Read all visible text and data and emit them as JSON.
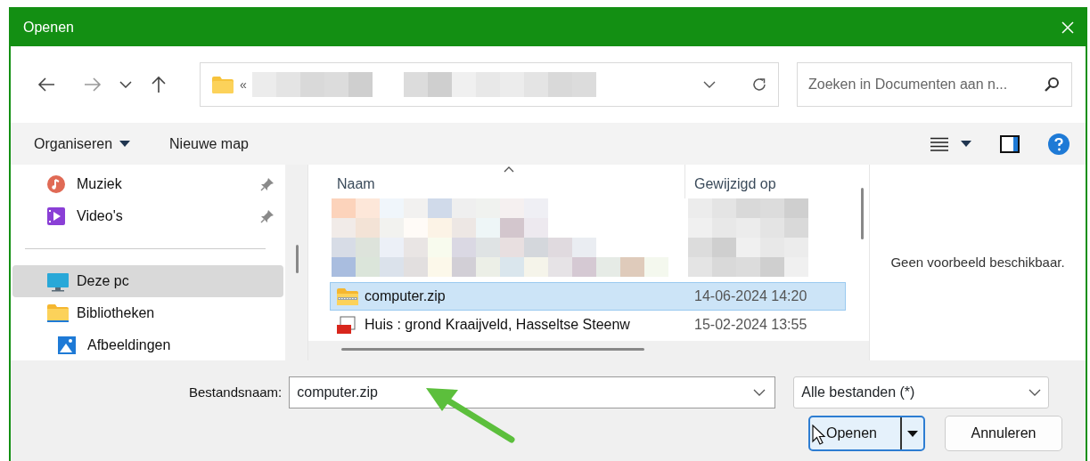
{
  "window": {
    "title": "Openen"
  },
  "navigation": {
    "address_prefix": "«"
  },
  "search": {
    "placeholder": "Zoeken in Documenten aan n..."
  },
  "toolbar": {
    "organize": "Organiseren",
    "new_folder": "Nieuwe map"
  },
  "sidebar": {
    "items": [
      {
        "kind": "music",
        "label": "Muziek",
        "pinned": true,
        "selected": false
      },
      {
        "kind": "video",
        "label": "Video's",
        "pinned": true,
        "selected": false
      },
      {
        "kind": "separator"
      },
      {
        "kind": "pc",
        "label": "Deze pc",
        "pinned": false,
        "selected": true
      },
      {
        "kind": "library",
        "label": "Bibliotheken",
        "pinned": false,
        "selected": false,
        "children": [
          {
            "kind": "pictures",
            "label": "Afbeeldingen",
            "pinned": false,
            "selected": false
          }
        ]
      }
    ]
  },
  "file_list": {
    "columns": [
      {
        "label": "Naam",
        "sorted": true
      },
      {
        "label": "Gewijzigd op",
        "sorted": false
      }
    ],
    "rows": [
      {
        "kind": "zip",
        "name": "computer.zip",
        "modified": "14-06-2024 14:20",
        "selected": true
      },
      {
        "kind": "jpg",
        "name": "Huis : grond Kraaijveld, Hasseltse Steenw",
        "modified": "15-02-2024 13:55",
        "selected": false
      }
    ]
  },
  "preview": {
    "text": "Geen voorbeeld beschikbaar."
  },
  "filename": {
    "label": "Bestandsnaam:",
    "value": "computer.zip"
  },
  "filter": {
    "value": "Alle bestanden (*)"
  },
  "buttons": {
    "open": "Openen",
    "cancel": "Annuleren"
  }
}
